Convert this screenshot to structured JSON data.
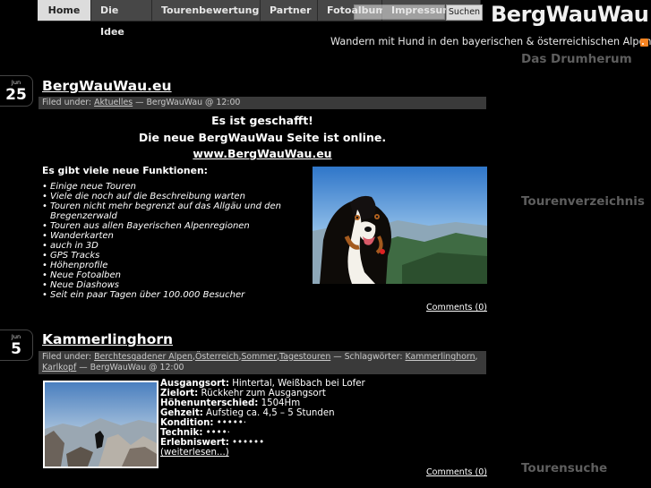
{
  "nav": {
    "tabs": [
      {
        "label": "Home",
        "active": true
      },
      {
        "label": "Die Idee"
      },
      {
        "label": "Tourenbewertung"
      },
      {
        "label": "Partner"
      },
      {
        "label": "Fotoalbum"
      },
      {
        "label": "Impressum"
      }
    ]
  },
  "search": {
    "button": "Suchen"
  },
  "site": {
    "title": "BergWauWau",
    "tagline": "Wandern mit Hund in den bayerischen & österreichischen Alpen"
  },
  "sidebar": {
    "drumherum": "Das Drumherum",
    "tourenverzeichnis": "Tourenverzeichnis",
    "tourensuche": "Tourensuche"
  },
  "post1": {
    "month": "Jun",
    "day": "25",
    "title": "BergWauWau.eu",
    "meta_prefix": "Filed under: ",
    "meta_category": "Aktuelles",
    "meta_suffix": " — BergWauWau @ 12:00",
    "headline1": "Es ist geschafft!",
    "headline2": "Die neue BergWauWau Seite ist online.",
    "link": "www.BergWauWau.eu",
    "intro": "Es gibt viele neue Funktionen:",
    "features": [
      "Einige neue Touren",
      "Viele die noch auf die Beschreibung warten",
      "Touren nicht mehr begrenzt auf das Allgäu und den Bregenzerwald",
      "Touren aus allen Bayerischen Alpenregionen",
      "Wanderkarten",
      "auch in 3D",
      "GPS Tracks",
      "Höhenprofile",
      "Neue Fotoalben",
      "Neue Diashows",
      "Seit ein paar Tagen über 100.000 Besucher"
    ],
    "comments": "Comments (0)"
  },
  "post2": {
    "month": "Jun",
    "day": "5",
    "title": "Kammerlinghorn",
    "meta_prefix": "Filed under: ",
    "meta_cats": "Berchtesgadener Alpen",
    "meta_c2": "Österreich",
    "meta_c3": "Sommer",
    "meta_c4": "Tagestouren",
    "meta_tags_label": " — Schlagwörter: ",
    "meta_tag1": "Kammerlinghorn",
    "meta_tag2": "Karlkopf",
    "meta_suffix": " — BergWauWau @ 12:00",
    "details": [
      {
        "key": "Ausgangsort:",
        "value": " Hintertal, Weißbach bei Lofer"
      },
      {
        "key": "Zielort:",
        "value": " Rückkehr zum Ausgangsort"
      },
      {
        "key": "Höhenunterschied:",
        "value": " 1504Hm"
      },
      {
        "key": "Gehzeit:",
        "value": " Aufstieg ca. 4,5 – 5 Stunden"
      },
      {
        "key": "Kondition:",
        "value": " •••••·"
      },
      {
        "key": "Technik:",
        "value": " ••••·"
      },
      {
        "key": "Erlebniswert:",
        "value": " ••••••"
      }
    ],
    "more": "(weiterlesen...)",
    "comments": "Comments (0)"
  }
}
